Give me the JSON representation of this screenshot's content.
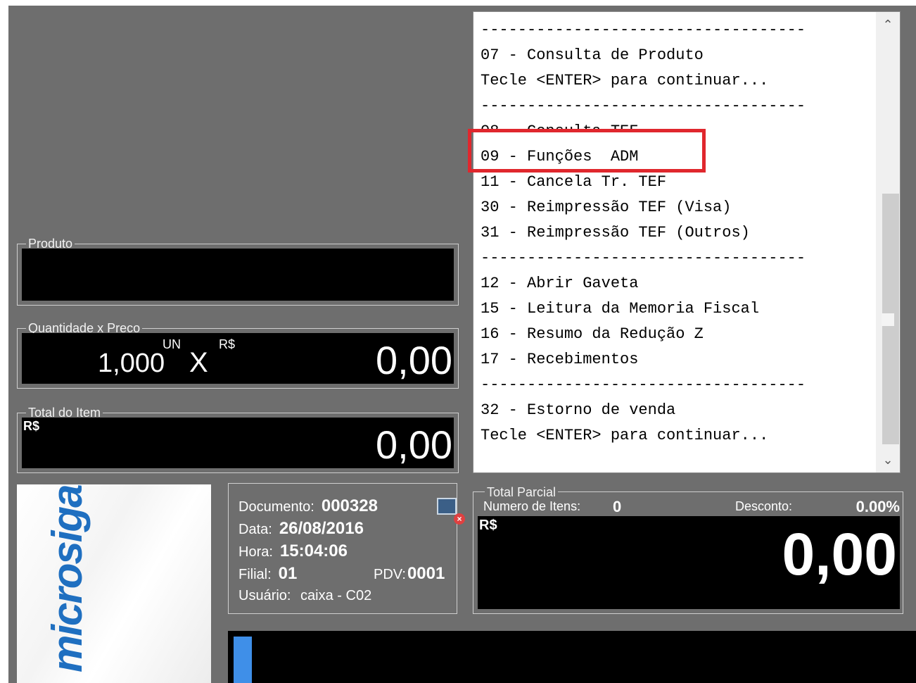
{
  "menu": {
    "lines": [
      "-----------------------------------",
      "07 - Consulta de Produto",
      "Tecle <ENTER> para continuar...",
      "-----------------------------------",
      "08 - Consulta TEF",
      "09 - Funções  ADM",
      "11 - Cancela Tr. TEF",
      "30 - Reimpressão TEF (Visa)",
      "31 - Reimpressão TEF (Outros)",
      "-----------------------------------",
      "12 - Abrir Gaveta",
      "15 - Leitura da Memoria Fiscal",
      "16 - Resumo da Redução Z",
      "17 - Recebimentos",
      "-----------------------------------",
      "32 - Estorno de venda",
      "Tecle <ENTER> para continuar..."
    ],
    "scroll_up_icon": "chevron-up-icon",
    "scroll_down_icon": "chevron-down-icon"
  },
  "produto": {
    "label": "Produto",
    "value": ""
  },
  "quantidade_preco": {
    "label": "Quantidade x Preco",
    "quantity": "1,000",
    "unit": "UN",
    "times": "X",
    "currency": "R$",
    "price": "0,00"
  },
  "total_item": {
    "label": "Total do Item",
    "currency": "R$",
    "value": "0,00"
  },
  "logo": {
    "text": "microsiga"
  },
  "info": {
    "documento_label": "Documento:",
    "documento": "000328",
    "data_label": "Data:",
    "data": "26/08/2016",
    "hora_label": "Hora:",
    "hora": "15:04:06",
    "filial_label": "Filial:",
    "filial": "01",
    "pdv_label": "PDV:",
    "pdv": "0001",
    "usuario_label": "Usuário:",
    "usuario": "caixa - C02",
    "status_icon": "computer-disconnected-icon"
  },
  "total_parcial": {
    "label": "Total Parcial",
    "itens_label": "Numero de Itens:",
    "itens": "0",
    "desconto_label": "Desconto:",
    "desconto": "0.00%",
    "currency": "R$",
    "value": "0,00"
  },
  "colors": {
    "background": "#6e6e6e",
    "highlight": "#e0272d",
    "accent": "#3f8fe8"
  }
}
